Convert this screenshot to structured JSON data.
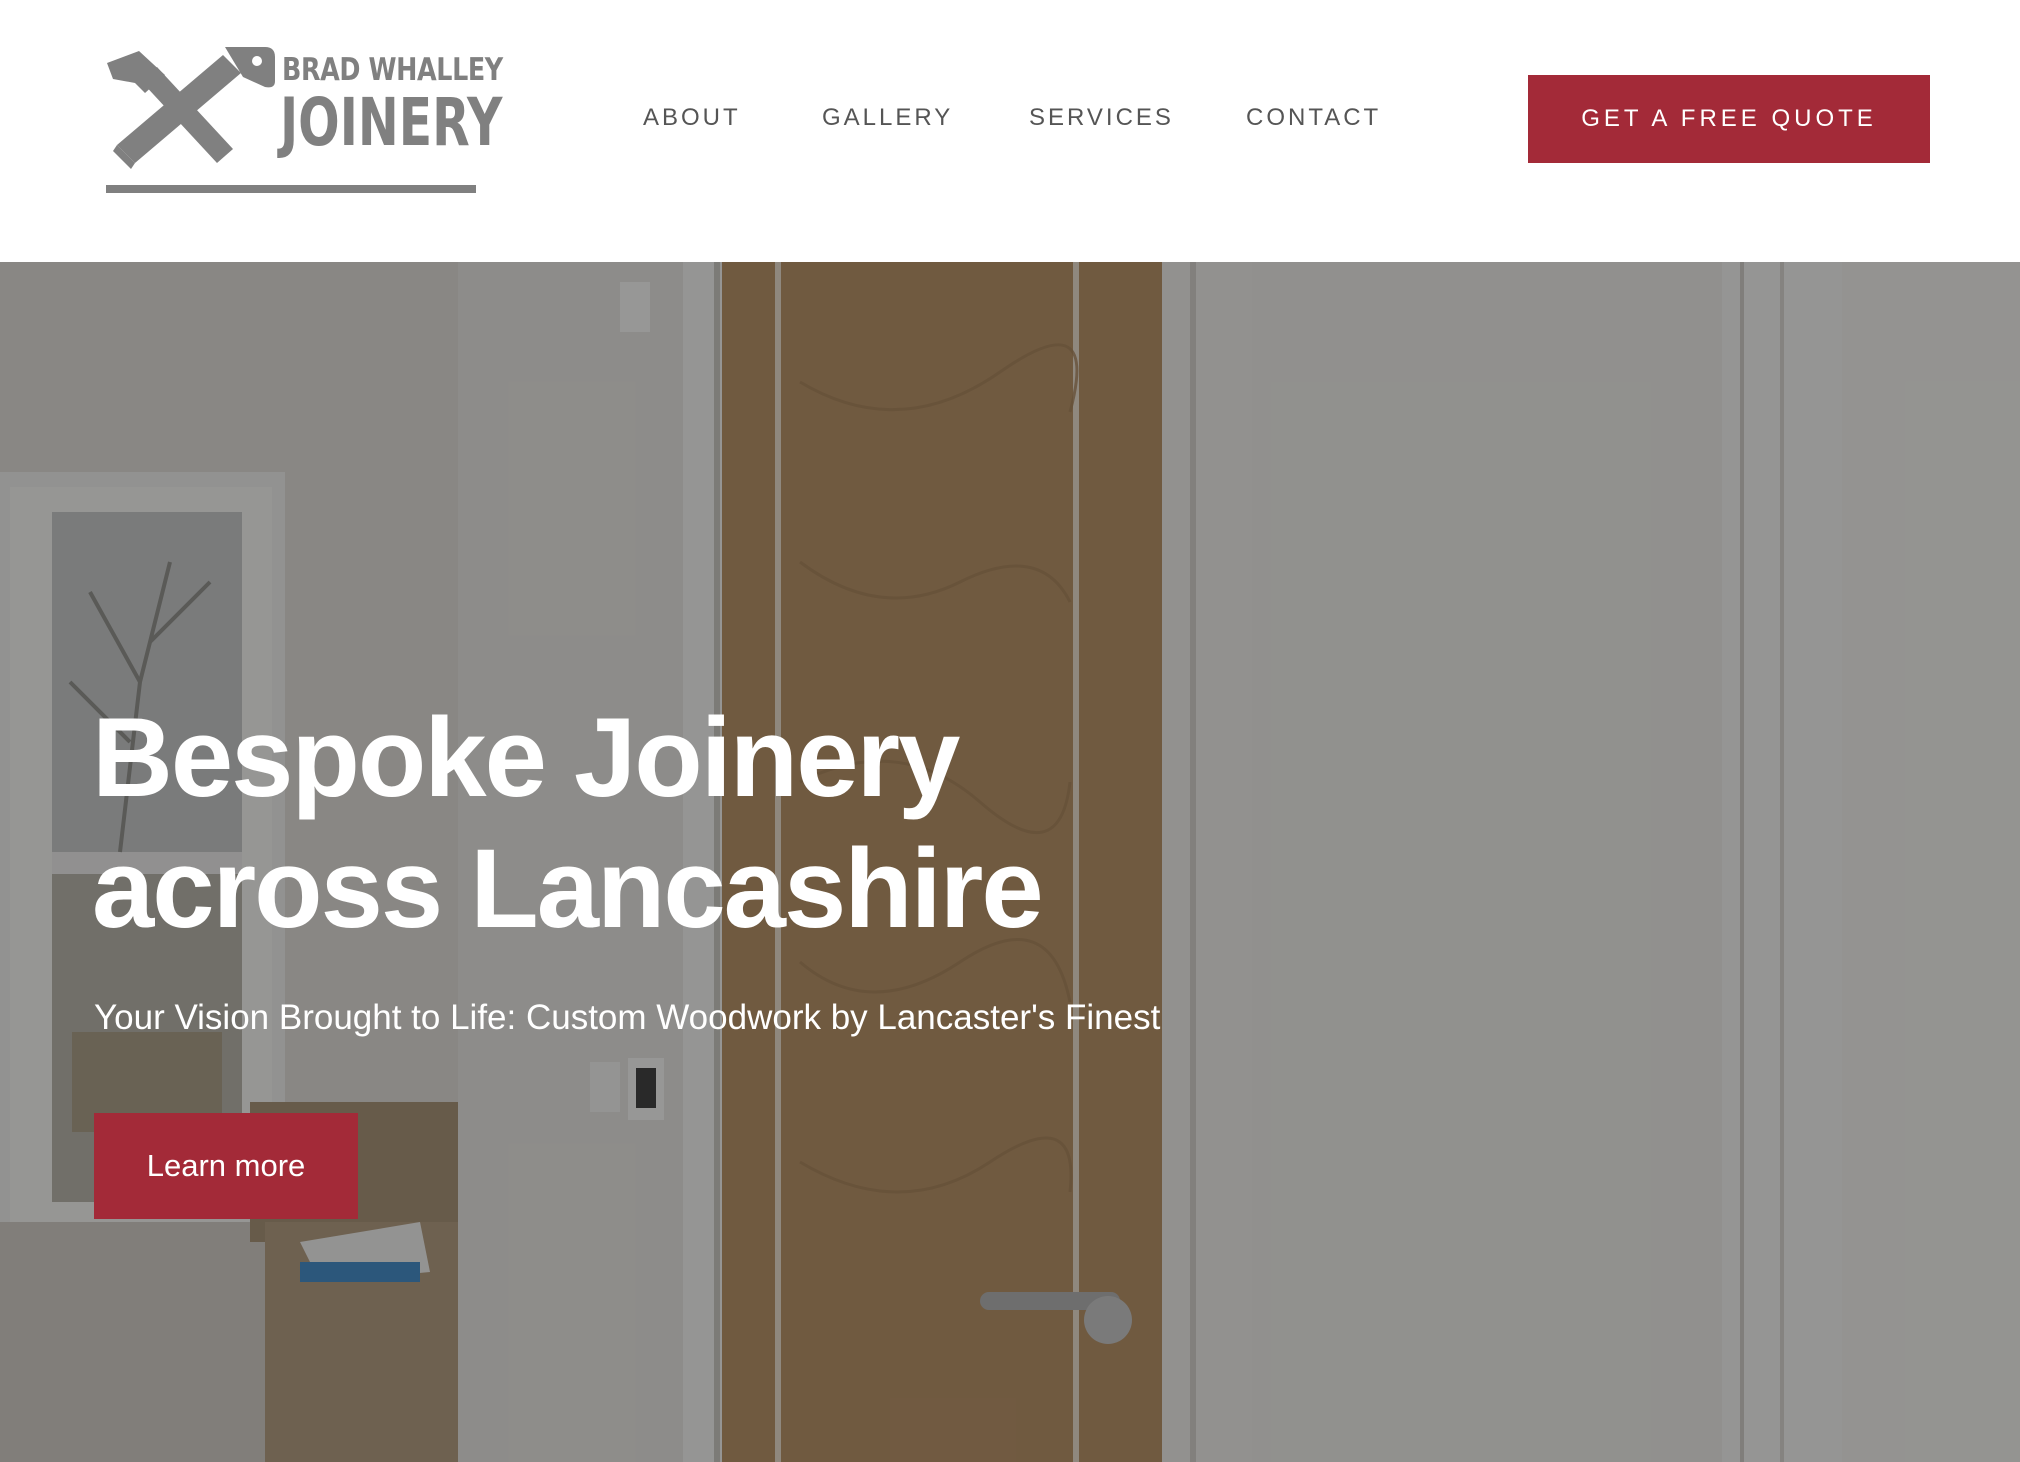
{
  "brand": {
    "line1": "BRAD WHALLEY",
    "line2": "JOINERY"
  },
  "nav": {
    "items": [
      {
        "label": "ABOUT"
      },
      {
        "label": "GALLERY"
      },
      {
        "label": "SERVICES"
      },
      {
        "label": "CONTACT"
      }
    ]
  },
  "header": {
    "cta_label": "GET A FREE QUOTE"
  },
  "hero": {
    "title_line1": "Bespoke Joinery",
    "title_line2": "across Lancashire",
    "subtitle": "Your Vision Brought to Life: Custom Woodwork by Lancaster's Finest",
    "button_label": "Learn more"
  },
  "colors": {
    "accent": "#a32a38",
    "logo_gray": "#808080",
    "nav_text": "#555555"
  }
}
